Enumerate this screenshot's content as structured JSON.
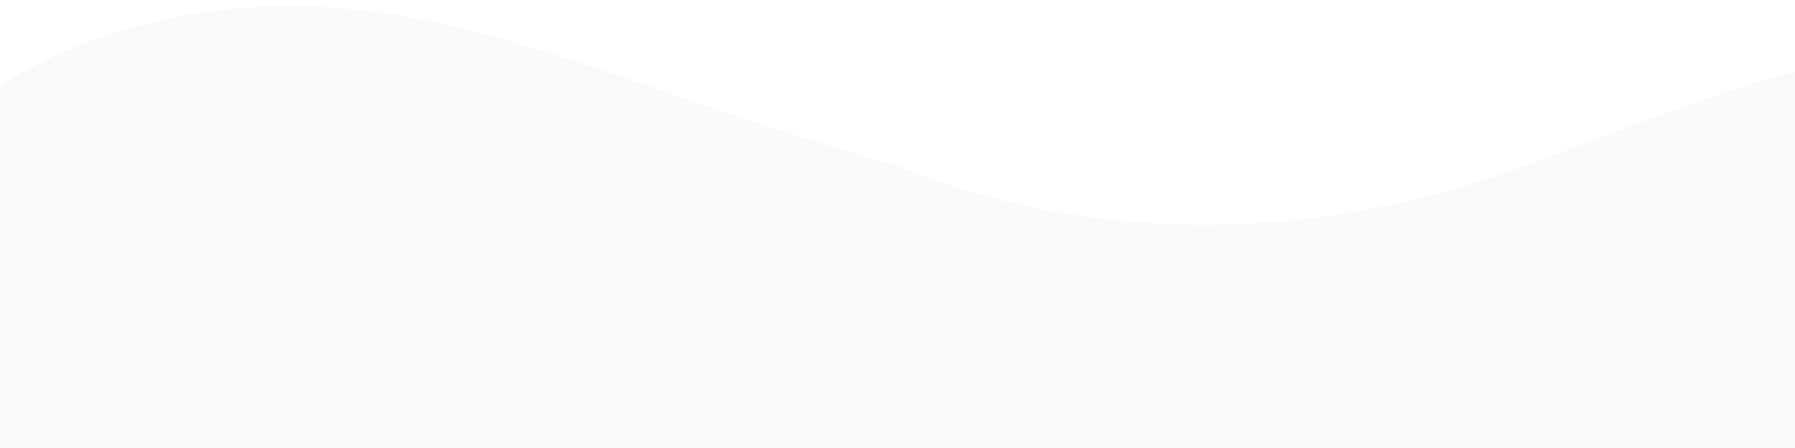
{
  "colors": {
    "background": "#ffffff",
    "wave_fill": "#f8f9fb"
  },
  "shapes": {
    "wave": "wave-divider-shape"
  }
}
